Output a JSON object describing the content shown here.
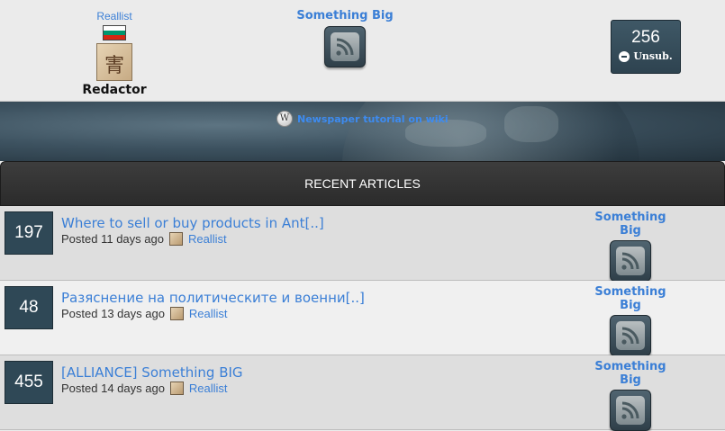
{
  "author": {
    "name": "Reallist",
    "role": "Redactor",
    "flag_colors": [
      "#ffffff",
      "#00966e",
      "#d62612"
    ]
  },
  "newspaper": {
    "name": "Something Big",
    "icon": "rss-feed-icon"
  },
  "subscribers": {
    "count": "256",
    "unsub_label": "Unsub."
  },
  "banner": {
    "tutorial_link": "Newspaper tutorial on wiki",
    "icon": "wikipedia-icon"
  },
  "recent": {
    "header": "RECENT ARTICLES",
    "articles": [
      {
        "votes": "197",
        "title": "Where to sell or buy products in Ant[..]",
        "posted": "Posted 11 days ago",
        "author": "Reallist",
        "paper": "Something Big"
      },
      {
        "votes": "48",
        "title": "Разяснение на политическите и военни[..]",
        "posted": "Posted 13 days ago",
        "author": "Reallist",
        "paper": "Something Big"
      },
      {
        "votes": "455",
        "title": "[ALLIANCE] Something BIG",
        "posted": "Posted 14 days ago",
        "author": "Reallist",
        "paper": "Something Big"
      }
    ]
  },
  "colors": {
    "link": "#3b7fd6",
    "vote_box": "#2f4856",
    "header_bar": "#2b2b2b"
  }
}
